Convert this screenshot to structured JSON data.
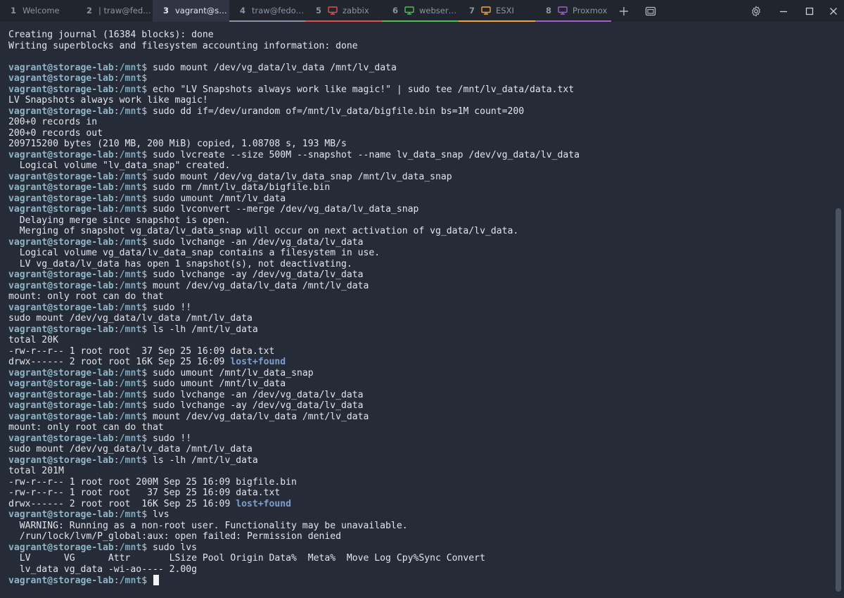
{
  "window": {
    "colors": {
      "background": "#262c37",
      "tabbar": "#20252e",
      "active_tab": "#2f3542",
      "prompt_user": "#8fb5c6",
      "directory": "#7c9fd0"
    }
  },
  "tabs": [
    {
      "num": "1",
      "title": "Welcome",
      "icon": null,
      "color": null,
      "active": false
    },
    {
      "num": "2",
      "title": "| traw@fed…",
      "icon": null,
      "color": null,
      "active": false
    },
    {
      "num": "3",
      "title": "vagrant@s…",
      "icon": null,
      "color": null,
      "active": true
    },
    {
      "num": "4",
      "title": "traw@fedo…",
      "icon": null,
      "color": "#8a96a6",
      "active": false
    },
    {
      "num": "5",
      "title": "zabbix",
      "icon": "monitor-icon",
      "color": "#e05252",
      "active": false
    },
    {
      "num": "6",
      "title": "webserver",
      "icon": "monitor-icon",
      "color": "#4fbf5a",
      "active": false
    },
    {
      "num": "7",
      "title": "ESXI",
      "icon": "monitor-icon",
      "color": "#f2a33a",
      "active": false
    },
    {
      "num": "8",
      "title": "Proxmox",
      "icon": "monitor-icon",
      "color": "#a45fd1",
      "active": false
    }
  ],
  "toolbar": {
    "new_tab_icon": "plus-icon",
    "tab_overview_icon": "windows-icon",
    "settings_icon": "gear-icon",
    "minimize_icon": "minimize-icon",
    "maximize_icon": "maximize-icon",
    "close_icon": "close-icon"
  },
  "terminal": {
    "prompt": {
      "user": "vagrant@storage-lab",
      "sep": ":",
      "path": "/mnt",
      "sym": "$ "
    },
    "lines": [
      {
        "t": "out",
        "text": "Creating journal (16384 blocks): done"
      },
      {
        "t": "out",
        "text": "Writing superblocks and filesystem accounting information: done"
      },
      {
        "t": "out",
        "text": ""
      },
      {
        "t": "cmd",
        "text": "sudo mount /dev/vg_data/lv_data /mnt/lv_data"
      },
      {
        "t": "cmd",
        "text": ""
      },
      {
        "t": "cmd",
        "text": "echo \"LV Snapshots always work like magic!\" | sudo tee /mnt/lv_data/data.txt"
      },
      {
        "t": "out",
        "text": "LV Snapshots always work like magic!"
      },
      {
        "t": "cmd",
        "text": "sudo dd if=/dev/urandom of=/mnt/lv_data/bigfile.bin bs=1M count=200"
      },
      {
        "t": "out",
        "text": "200+0 records in"
      },
      {
        "t": "out",
        "text": "200+0 records out"
      },
      {
        "t": "out",
        "text": "209715200 bytes (210 MB, 200 MiB) copied, 1.08708 s, 193 MB/s"
      },
      {
        "t": "cmd",
        "text": "sudo lvcreate --size 500M --snapshot --name lv_data_snap /dev/vg_data/lv_data"
      },
      {
        "t": "out",
        "text": "  Logical volume \"lv_data_snap\" created."
      },
      {
        "t": "cmd",
        "text": "sudo mount /dev/vg_data/lv_data_snap /mnt/lv_data_snap"
      },
      {
        "t": "cmd",
        "text": "sudo rm /mnt/lv_data/bigfile.bin"
      },
      {
        "t": "cmd",
        "text": "sudo umount /mnt/lv_data"
      },
      {
        "t": "cmd",
        "text": "sudo lvconvert --merge /dev/vg_data/lv_data_snap"
      },
      {
        "t": "out",
        "text": "  Delaying merge since snapshot is open."
      },
      {
        "t": "out",
        "text": "  Merging of snapshot vg_data/lv_data_snap will occur on next activation of vg_data/lv_data."
      },
      {
        "t": "cmd",
        "text": "sudo lvchange -an /dev/vg_data/lv_data"
      },
      {
        "t": "out",
        "text": "  Logical volume vg_data/lv_data_snap contains a filesystem in use."
      },
      {
        "t": "out",
        "text": "  LV vg_data/lv_data has open 1 snapshot(s), not deactivating."
      },
      {
        "t": "cmd",
        "text": "sudo lvchange -ay /dev/vg_data/lv_data"
      },
      {
        "t": "cmd",
        "text": "mount /dev/vg_data/lv_data /mnt/lv_data"
      },
      {
        "t": "out",
        "text": "mount: only root can do that"
      },
      {
        "t": "cmd",
        "text": "sudo !!"
      },
      {
        "t": "out",
        "text": "sudo mount /dev/vg_data/lv_data /mnt/lv_data"
      },
      {
        "t": "cmd",
        "text": "ls -lh /mnt/lv_data"
      },
      {
        "t": "out",
        "text": "total 20K"
      },
      {
        "t": "out",
        "text": "-rw-r--r-- 1 root root  37 Sep 25 16:09 data.txt"
      },
      {
        "t": "dir",
        "text": "drwx------ 2 root root 16K Sep 25 16:09 ",
        "dir": "lost+found"
      },
      {
        "t": "cmd",
        "text": "sudo umount /mnt/lv_data_snap"
      },
      {
        "t": "cmd",
        "text": "sudo umount /mnt/lv_data"
      },
      {
        "t": "cmd",
        "text": "sudo lvchange -an /dev/vg_data/lv_data"
      },
      {
        "t": "cmd",
        "text": "sudo lvchange -ay /dev/vg_data/lv_data"
      },
      {
        "t": "cmd",
        "text": "mount /dev/vg_data/lv_data /mnt/lv_data"
      },
      {
        "t": "out",
        "text": "mount: only root can do that"
      },
      {
        "t": "cmd",
        "text": "sudo !!"
      },
      {
        "t": "out",
        "text": "sudo mount /dev/vg_data/lv_data /mnt/lv_data"
      },
      {
        "t": "cmd",
        "text": "ls -lh /mnt/lv_data"
      },
      {
        "t": "out",
        "text": "total 201M"
      },
      {
        "t": "out",
        "text": "-rw-r--r-- 1 root root 200M Sep 25 16:09 bigfile.bin"
      },
      {
        "t": "out",
        "text": "-rw-r--r-- 1 root root   37 Sep 25 16:09 data.txt"
      },
      {
        "t": "dir",
        "text": "drwx------ 2 root root  16K Sep 25 16:09 ",
        "dir": "lost+found"
      },
      {
        "t": "cmd",
        "text": "lvs"
      },
      {
        "t": "out",
        "text": "  WARNING: Running as a non-root user. Functionality may be unavailable."
      },
      {
        "t": "out",
        "text": "  /run/lock/lvm/P_global:aux: open failed: Permission denied"
      },
      {
        "t": "cmd",
        "text": "sudo lvs"
      },
      {
        "t": "out",
        "text": "  LV      VG      Attr       LSize Pool Origin Data%  Meta%  Move Log Cpy%Sync Convert"
      },
      {
        "t": "out",
        "text": "  lv_data vg_data -wi-ao---- 2.00g"
      },
      {
        "t": "cursor",
        "text": ""
      }
    ]
  }
}
